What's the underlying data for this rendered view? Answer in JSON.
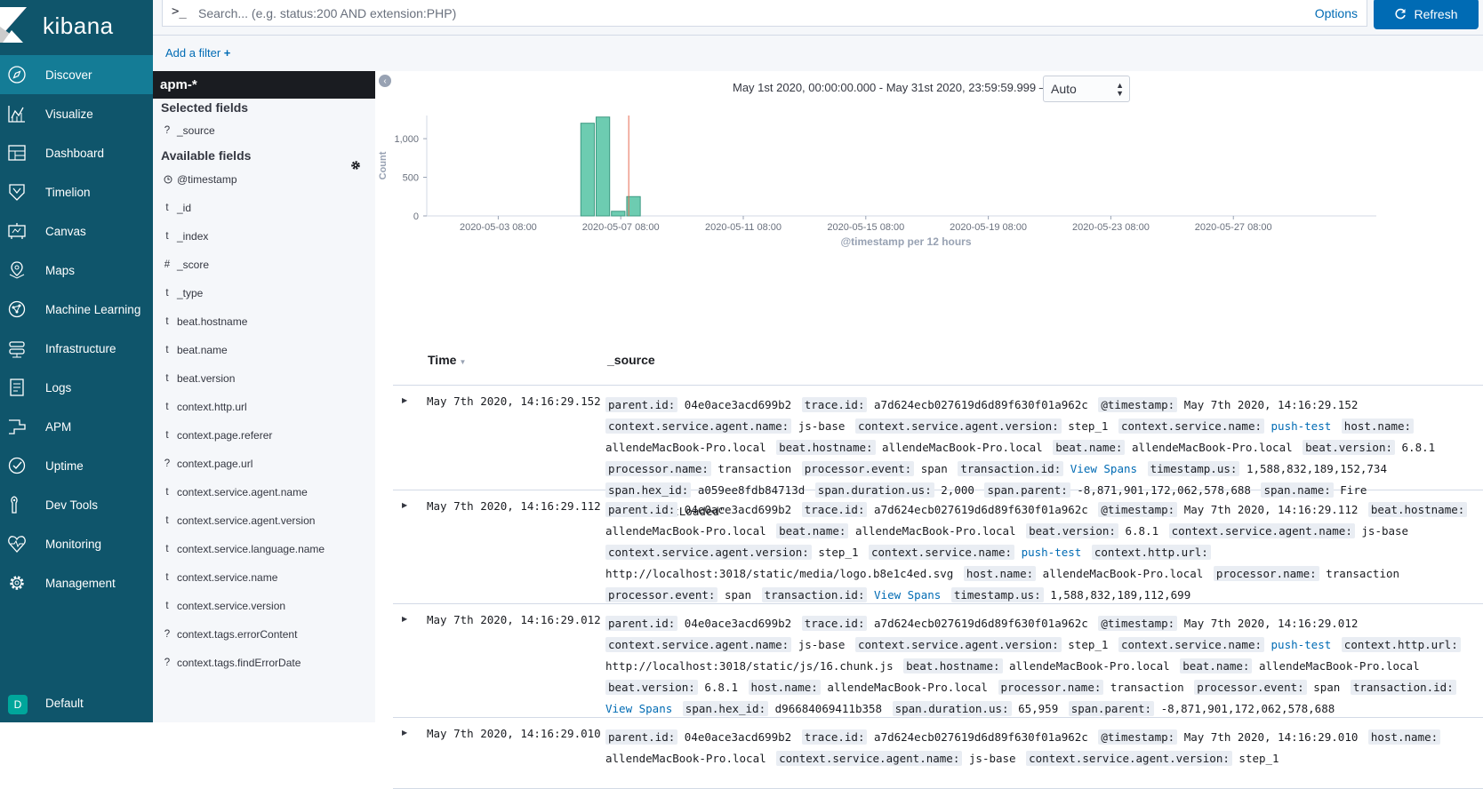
{
  "app": {
    "logo_text": "kibana"
  },
  "nav": {
    "items": [
      {
        "label": "Discover",
        "icon": "compass-icon",
        "active": true
      },
      {
        "label": "Visualize",
        "icon": "visualize-icon"
      },
      {
        "label": "Dashboard",
        "icon": "dashboard-icon"
      },
      {
        "label": "Timelion",
        "icon": "timelion-icon"
      },
      {
        "label": "Canvas",
        "icon": "canvas-icon"
      },
      {
        "label": "Maps",
        "icon": "maps-icon"
      },
      {
        "label": "Machine Learning",
        "icon": "machine-learning-icon"
      },
      {
        "label": "Infrastructure",
        "icon": "infrastructure-icon"
      },
      {
        "label": "Logs",
        "icon": "logs-icon"
      },
      {
        "label": "APM",
        "icon": "apm-icon"
      },
      {
        "label": "Uptime",
        "icon": "uptime-icon"
      },
      {
        "label": "Dev Tools",
        "icon": "dev-tools-icon"
      },
      {
        "label": "Monitoring",
        "icon": "monitoring-icon"
      },
      {
        "label": "Management",
        "icon": "gear-icon"
      }
    ],
    "space": {
      "avatar": "D",
      "label": "Default"
    }
  },
  "search": {
    "prompt": ">_",
    "placeholder": "Search... (e.g. status:200 AND extension:PHP)",
    "value": "",
    "options_label": "Options",
    "refresh_label": "Refresh"
  },
  "filter": {
    "add_label": "Add a filter"
  },
  "sidebar": {
    "index_pattern": "apm-*",
    "selected_title": "Selected fields",
    "selected": [
      {
        "type": "?",
        "name": "_source"
      }
    ],
    "available_title": "Available fields",
    "available": [
      {
        "type": "clock",
        "name": "@timestamp"
      },
      {
        "type": "t",
        "name": "_id"
      },
      {
        "type": "t",
        "name": "_index"
      },
      {
        "type": "#",
        "name": "_score"
      },
      {
        "type": "t",
        "name": "_type"
      },
      {
        "type": "t",
        "name": "beat.hostname"
      },
      {
        "type": "t",
        "name": "beat.name"
      },
      {
        "type": "t",
        "name": "beat.version"
      },
      {
        "type": "t",
        "name": "context.http.url"
      },
      {
        "type": "t",
        "name": "context.page.referer"
      },
      {
        "type": "?",
        "name": "context.page.url"
      },
      {
        "type": "t",
        "name": "context.service.agent.name"
      },
      {
        "type": "t",
        "name": "context.service.agent.version"
      },
      {
        "type": "t",
        "name": "context.service.language.name"
      },
      {
        "type": "t",
        "name": "context.service.name"
      },
      {
        "type": "t",
        "name": "context.service.version"
      },
      {
        "type": "?",
        "name": "context.tags.errorContent"
      },
      {
        "type": "?",
        "name": "context.tags.findErrorDate"
      }
    ]
  },
  "time": {
    "range": "May 1st 2020, 00:00:00.000 - May 31st 2020, 23:59:59.999 —",
    "interval": "Auto"
  },
  "chart_data": {
    "type": "bar",
    "xlabel": "@timestamp per 12 hours",
    "ylabel": "Count",
    "ylim": [
      0,
      1300
    ],
    "yticks": [
      0,
      500,
      1000
    ],
    "ytick_labels": [
      "0",
      "500",
      "1,000"
    ],
    "xlim": [
      "2020-05-01 00:00",
      "2020-06-01 00:00"
    ],
    "xticks": [
      "2020-05-03 08:00",
      "2020-05-07 08:00",
      "2020-05-11 08:00",
      "2020-05-15 08:00",
      "2020-05-19 08:00",
      "2020-05-23 08:00",
      "2020-05-27 08:00"
    ],
    "x": [
      "2020-05-06 00:00",
      "2020-05-06 12:00",
      "2020-05-07 00:00",
      "2020-05-07 12:00"
    ],
    "values": [
      1200,
      1280,
      60,
      250
    ],
    "marker_time": "2020-05-07 14:16",
    "bar_color": "#6dccb1",
    "marker_color": "#e7664c"
  },
  "table": {
    "time_header": "Time",
    "source_header": "_source",
    "rows": [
      {
        "time": "May 7th 2020, 14:16:29.152",
        "fields": [
          {
            "k": "parent.id:",
            "v": "04e0ace3acd699b2"
          },
          {
            "k": "trace.id:",
            "v": "a7d624ecb027619d6d89f630f01a962c"
          },
          {
            "k": "@timestamp:",
            "v": "May 7th 2020, 14:16:29.152"
          },
          {
            "k": "context.service.agent.name:",
            "v": "js-base"
          },
          {
            "k": "context.service.agent.version:",
            "v": "step_1"
          },
          {
            "k": "context.service.name:",
            "v": "push-test",
            "link": true
          },
          {
            "k": "host.name:",
            "v": "allendeMacBook-Pro.local"
          },
          {
            "k": "beat.hostname:",
            "v": "allendeMacBook-Pro.local"
          },
          {
            "k": "beat.name:",
            "v": "allendeMacBook-Pro.local"
          },
          {
            "k": "beat.version:",
            "v": "6.8.1"
          },
          {
            "k": "processor.name:",
            "v": "transaction"
          },
          {
            "k": "processor.event:",
            "v": "span"
          },
          {
            "k": "transaction.id:",
            "v": "View Spans",
            "link": true
          },
          {
            "k": "timestamp.us:",
            "v": "1,588,832,189,152,734"
          },
          {
            "k": "span.hex_id:",
            "v": "a059ee8fdb84713d"
          },
          {
            "k": "span.duration.us:",
            "v": "2,000"
          },
          {
            "k": "span.parent:",
            "v": "-8,871,901,172,062,578,688"
          },
          {
            "k": "span.name:",
            "v": "Fire \"DOMContentLoaded\""
          }
        ]
      },
      {
        "time": "May 7th 2020, 14:16:29.112",
        "fields": [
          {
            "k": "parent.id:",
            "v": "04e0ace3acd699b2"
          },
          {
            "k": "trace.id:",
            "v": "a7d624ecb027619d6d89f630f01a962c"
          },
          {
            "k": "@timestamp:",
            "v": "May 7th 2020, 14:16:29.112"
          },
          {
            "k": "beat.hostname:",
            "v": "allendeMacBook-Pro.local"
          },
          {
            "k": "beat.name:",
            "v": "allendeMacBook-Pro.local"
          },
          {
            "k": "beat.version:",
            "v": "6.8.1"
          },
          {
            "k": "context.service.agent.name:",
            "v": "js-base"
          },
          {
            "k": "context.service.agent.version:",
            "v": "step_1"
          },
          {
            "k": "context.service.name:",
            "v": "push-test",
            "link": true
          },
          {
            "k": "context.http.url:",
            "v": "http://localhost:3018/static/media/logo.b8e1c4ed.svg"
          },
          {
            "k": "host.name:",
            "v": "allendeMacBook-Pro.local"
          },
          {
            "k": "processor.name:",
            "v": "transaction"
          },
          {
            "k": "processor.event:",
            "v": "span"
          },
          {
            "k": "transaction.id:",
            "v": "View Spans",
            "link": true
          },
          {
            "k": "timestamp.us:",
            "v": "1,588,832,189,112,699"
          }
        ]
      },
      {
        "time": "May 7th 2020, 14:16:29.012",
        "fields": [
          {
            "k": "parent.id:",
            "v": "04e0ace3acd699b2"
          },
          {
            "k": "trace.id:",
            "v": "a7d624ecb027619d6d89f630f01a962c"
          },
          {
            "k": "@timestamp:",
            "v": "May 7th 2020, 14:16:29.012"
          },
          {
            "k": "context.service.agent.name:",
            "v": "js-base"
          },
          {
            "k": "context.service.agent.version:",
            "v": "step_1"
          },
          {
            "k": "context.service.name:",
            "v": "push-test",
            "link": true
          },
          {
            "k": "context.http.url:",
            "v": "http://localhost:3018/static/js/16.chunk.js"
          },
          {
            "k": "beat.hostname:",
            "v": "allendeMacBook-Pro.local"
          },
          {
            "k": "beat.name:",
            "v": "allendeMacBook-Pro.local"
          },
          {
            "k": "beat.version:",
            "v": "6.8.1"
          },
          {
            "k": "host.name:",
            "v": "allendeMacBook-Pro.local"
          },
          {
            "k": "processor.name:",
            "v": "transaction"
          },
          {
            "k": "processor.event:",
            "v": "span"
          },
          {
            "k": "transaction.id:",
            "v": "View Spans",
            "link": true
          },
          {
            "k": "span.hex_id:",
            "v": "d96684069411b358"
          },
          {
            "k": "span.duration.us:",
            "v": "65,959"
          },
          {
            "k": "span.parent:",
            "v": "-8,871,901,172,062,578,688"
          }
        ]
      },
      {
        "time": "May 7th 2020, 14:16:29.010",
        "fields": [
          {
            "k": "parent.id:",
            "v": "04e0ace3acd699b2"
          },
          {
            "k": "trace.id:",
            "v": "a7d624ecb027619d6d89f630f01a962c"
          },
          {
            "k": "@timestamp:",
            "v": "May 7th 2020, 14:16:29.010"
          },
          {
            "k": "host.name:",
            "v": "allendeMacBook-Pro.local"
          },
          {
            "k": "context.service.agent.name:",
            "v": "js-base"
          },
          {
            "k": "context.service.agent.version:",
            "v": "step_1"
          }
        ]
      }
    ]
  }
}
